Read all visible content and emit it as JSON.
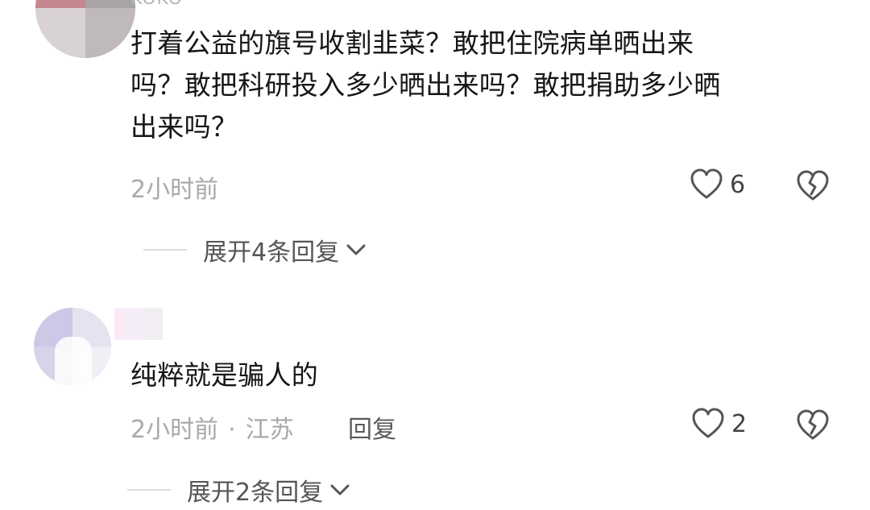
{
  "comments": [
    {
      "username": "KOKO",
      "text": "打着公益的旗号收割韭菜？敢把住院病单晒出来\n吗？敢把科研投入多少晒出来吗？敢把捐助多少晒\n出来吗？",
      "time": "2小时前",
      "likes": "6",
      "expand_label": "展开4条回复",
      "icons": {
        "like": "heart-outline-icon",
        "dislike": "broken-heart-icon",
        "expand": "chevron-down-icon"
      }
    },
    {
      "text": "纯粹就是骗人的",
      "time": "2小时前",
      "separator": "·",
      "location": "江苏",
      "reply_label": "回复",
      "likes": "2",
      "expand_label": "展开2条回复",
      "icons": {
        "like": "heart-outline-icon",
        "dislike": "broken-heart-icon",
        "expand": "chevron-down-icon"
      }
    }
  ],
  "colors": {
    "text_primary": "#161616",
    "text_meta": "#a9a9a9",
    "icon_stroke": "#555555",
    "divider": "#dcdcdc"
  }
}
